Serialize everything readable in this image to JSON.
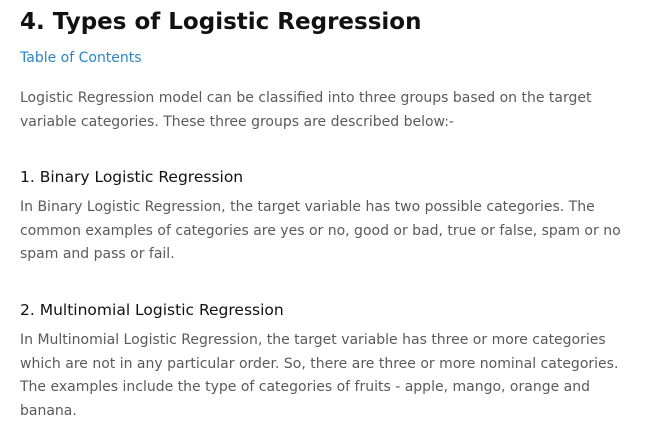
{
  "section": {
    "title": "4. Types of Logistic Regression",
    "toc_link": "Table of Contents",
    "intro": "Logistic Regression model can be classified into three groups based on the target variable categories. These three groups are described below:-"
  },
  "subsections": [
    {
      "heading": "1. Binary Logistic Regression",
      "body": "In Binary Logistic Regression, the target variable has two possible categories. The common examples of categories are yes or no, good or bad, true or false, spam or no spam and pass or fail."
    },
    {
      "heading": "2. Multinomial Logistic Regression",
      "body": "In Multinomial Logistic Regression, the target variable has three or more categories which are not in any particular order. So, there are three or more nominal categories. The examples include the type of categories of fruits - apple, mango, orange and banana."
    }
  ],
  "colors": {
    "heading": "#111111",
    "body_text": "#5a5a5a",
    "link": "#2a86c6"
  }
}
